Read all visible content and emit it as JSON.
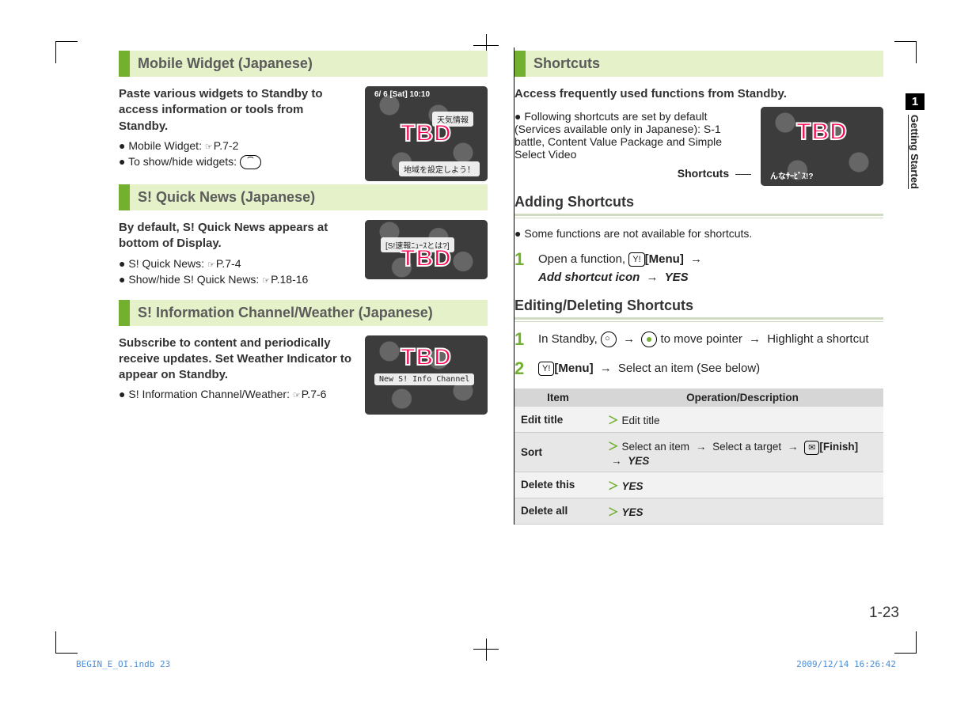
{
  "chapter": {
    "number": "1",
    "name": "Getting Started"
  },
  "page_number": "1-23",
  "footer": {
    "file": "BEGIN_E_OI.indb   23",
    "timestamp": "2009/12/14   16:26:42"
  },
  "left": {
    "mobile_widget": {
      "heading": "Mobile Widget (Japanese)",
      "intro": "Paste various widgets to Standby to access information or tools from Standby.",
      "bullets": [
        {
          "text": "Mobile Widget:",
          "ref": "P.7-2"
        },
        {
          "text": "To show/hide widgets:",
          "key": true
        }
      ],
      "thumb": {
        "tbd": "TBD",
        "top": "6/  6 [Sat] 10:10",
        "mid": "天気情報",
        "bottom": "地域を設定しよう！"
      }
    },
    "quick_news": {
      "heading": "S! Quick News (Japanese)",
      "intro": "By default, S! Quick News appears at bottom of Display.",
      "bullets": [
        {
          "text": "S! Quick News:",
          "ref": "P.7-4"
        },
        {
          "text": "Show/hide S! Quick News:",
          "ref": "P.18-16"
        }
      ],
      "thumb": {
        "tbd": "TBD",
        "label": "[S!速報ﾆｭｰｽとは?]"
      }
    },
    "info_channel": {
      "heading": "S! Information Channel/Weather (Japanese)",
      "intro": "Subscribe to content and periodically receive updates. Set Weather Indicator to appear on Standby.",
      "bullets": [
        {
          "text": "S! Information Channel/Weather:",
          "ref": "P.7-6"
        }
      ],
      "thumb": {
        "tbd": "TBD",
        "label": "New S! Info Channel"
      }
    }
  },
  "right": {
    "heading": "Shortcuts",
    "intro": "Access frequently used functions from Standby.",
    "bullet": "Following shortcuts are set by default (Services available only in Japanese): S-1 battle, Content Value Package and Simple Select Video",
    "thumb": {
      "tbd": "TBD",
      "bottom": "んなｻｰﾋﾞｽ!?"
    },
    "shortcut_label": "Shortcuts",
    "adding": {
      "heading": "Adding Shortcuts",
      "note": "Some functions are not available for shortcuts.",
      "step1_a": "Open a function,",
      "step1_b": "[Menu]",
      "step1_c": "Add shortcut icon",
      "step1_d": "YES"
    },
    "editing": {
      "heading": "Editing/Deleting Shortcuts",
      "step1_a": "In Standby,",
      "step1_b": "to move pointer",
      "step1_c": "Highlight a shortcut",
      "step2_a": "[Menu]",
      "step2_b": "Select an item (See below)"
    },
    "table": {
      "head_item": "Item",
      "head_op": "Operation/Description",
      "rows": [
        {
          "item": "Edit title",
          "op": "Edit title"
        },
        {
          "item": "Sort",
          "op_a": "Select an item",
          "op_b": "Select a target",
          "op_c": "[Finish]",
          "op_d": "YES"
        },
        {
          "item": "Delete this",
          "op": "YES",
          "italic": true
        },
        {
          "item": "Delete all",
          "op": "YES",
          "italic": true
        }
      ]
    }
  }
}
